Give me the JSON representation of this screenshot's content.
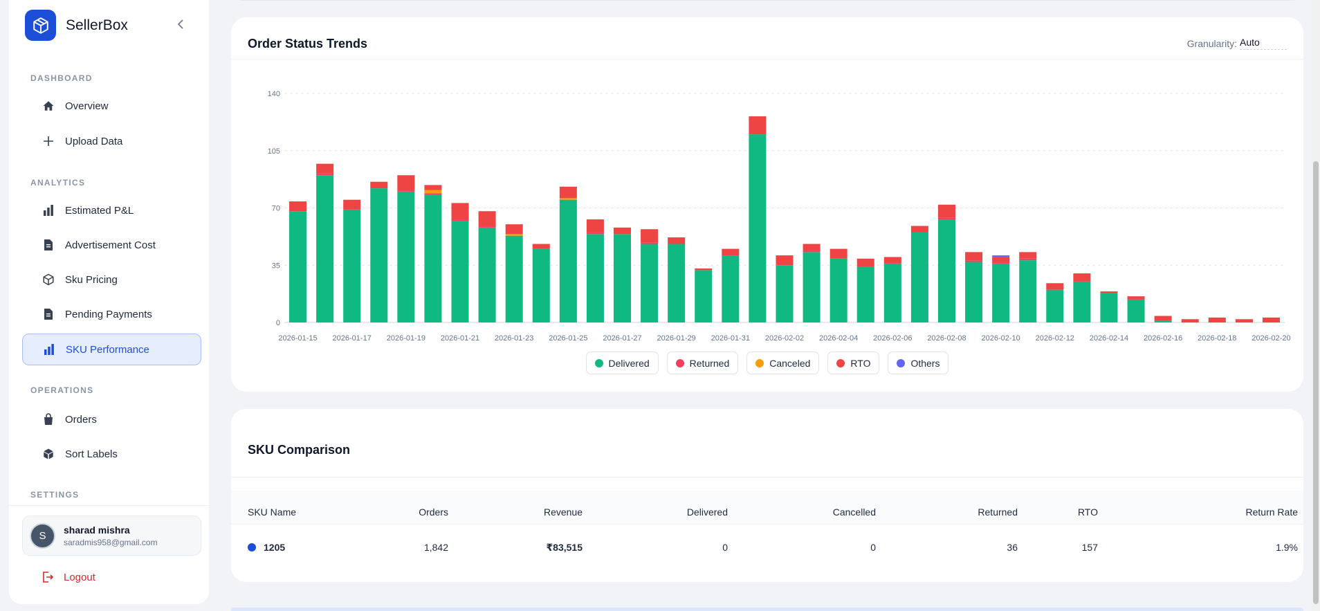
{
  "app": {
    "name": "SellerBox"
  },
  "sidebar": {
    "sections": {
      "dashboard": "DASHBOARD",
      "analytics": "ANALYTICS",
      "operations": "OPERATIONS",
      "settings": "SETTINGS"
    },
    "items": {
      "overview": "Overview",
      "upload": "Upload Data",
      "pnl": "Estimated P&L",
      "ads": "Advertisement Cost",
      "pricing": "Sku Pricing",
      "pending": "Pending Payments",
      "sku_perf": "SKU Performance",
      "orders": "Orders",
      "labels": "Sort Labels"
    },
    "icons": {
      "overview": "home-icon",
      "upload": "plus-icon",
      "pnl": "bar-chart-icon",
      "ads": "document-icon",
      "pricing": "box-icon",
      "pending": "document-icon",
      "sku_perf": "bar-chart-icon",
      "orders": "shopping-bag-icon",
      "labels": "cube-icon"
    },
    "user": {
      "initial": "S",
      "name": "sharad mishra",
      "email": "saradmis958@gmail.com"
    },
    "logout": "Logout"
  },
  "chart_card": {
    "title": "Order Status Trends",
    "granularity_label": "Granularity:",
    "granularity_value": "Auto"
  },
  "chart_data": {
    "type": "bar",
    "stacked": true,
    "title": "Order Status Trends",
    "ylim": [
      0,
      140
    ],
    "yticks": [
      0,
      35,
      70,
      105,
      140
    ],
    "grid": true,
    "legend_position": "bottom",
    "categories": [
      "2026-01-15",
      "2026-01-16",
      "2026-01-17",
      "2026-01-18",
      "2026-01-19",
      "2026-01-20",
      "2026-01-21",
      "2026-01-22",
      "2026-01-23",
      "2026-01-24",
      "2026-01-25",
      "2026-01-26",
      "2026-01-27",
      "2026-01-28",
      "2026-01-29",
      "2026-01-30",
      "2026-01-31",
      "2026-02-01",
      "2026-02-02",
      "2026-02-03",
      "2026-02-04",
      "2026-02-05",
      "2026-02-06",
      "2026-02-07",
      "2026-02-08",
      "2026-02-09",
      "2026-02-10",
      "2026-02-11",
      "2026-02-12",
      "2026-02-13",
      "2026-02-14",
      "2026-02-15",
      "2026-02-16",
      "2026-02-17",
      "2026-02-18",
      "2026-02-19",
      "2026-02-20"
    ],
    "x_tick_labels": [
      "2026-01-15",
      "2026-01-17",
      "2026-01-19",
      "2026-01-21",
      "2026-01-23",
      "2026-01-25",
      "2026-01-27",
      "2026-01-29",
      "2026-01-31",
      "2026-02-02",
      "2026-02-04",
      "2026-02-06",
      "2026-02-08",
      "2026-02-10",
      "2026-02-12",
      "2026-02-14",
      "2026-02-16",
      "2026-02-18",
      "2026-02-20"
    ],
    "series": [
      {
        "name": "Delivered",
        "color": "#10b981",
        "values": [
          68,
          90,
          69,
          82,
          80,
          78,
          62,
          58,
          53,
          45,
          75,
          54,
          54,
          48,
          48,
          32,
          41,
          115,
          35,
          43,
          39,
          34,
          36,
          55,
          63,
          37,
          36,
          38,
          20,
          25,
          18,
          14,
          1,
          0,
          0,
          0,
          0
        ]
      },
      {
        "name": "Returned",
        "color": "#f43f5e",
        "values": [
          0,
          1,
          0,
          0,
          1,
          1,
          1,
          1,
          0,
          0,
          0,
          1,
          0,
          1,
          0,
          0,
          0,
          0,
          0,
          1,
          0,
          0,
          0,
          0,
          1,
          1,
          1,
          1,
          0,
          0,
          0,
          0,
          0,
          0,
          0,
          0,
          0
        ]
      },
      {
        "name": "Canceled",
        "color": "#f59e0b",
        "values": [
          0,
          0,
          0,
          0,
          0,
          2,
          0,
          0,
          1,
          0,
          1,
          0,
          0,
          0,
          0,
          0,
          0,
          0,
          0,
          0,
          0,
          0,
          0,
          0,
          0,
          0,
          0,
          0,
          0,
          0,
          0,
          0,
          0,
          0,
          0,
          0,
          0
        ]
      },
      {
        "name": "RTO",
        "color": "#ef4444",
        "values": [
          6,
          6,
          6,
          4,
          9,
          3,
          10,
          9,
          6,
          3,
          7,
          8,
          4,
          8,
          4,
          1,
          4,
          11,
          6,
          4,
          6,
          5,
          4,
          4,
          8,
          5,
          3,
          4,
          4,
          5,
          1,
          2,
          3,
          2,
          3,
          2,
          3
        ]
      },
      {
        "name": "Others",
        "color": "#6366f1",
        "values": [
          0,
          0,
          0,
          0,
          0,
          0,
          0,
          0,
          0,
          0,
          0,
          0,
          0,
          0,
          0,
          0,
          0,
          0,
          0,
          0,
          0,
          0,
          0,
          0,
          0,
          0,
          1,
          0,
          0,
          0,
          0,
          0,
          0,
          0,
          0,
          0,
          0
        ]
      }
    ]
  },
  "table_card": {
    "title": "SKU Comparison",
    "headers": {
      "sku": "SKU Name",
      "orders": "Orders",
      "revenue": "Revenue",
      "delivered": "Delivered",
      "cancelled": "Cancelled",
      "returned": "Returned",
      "rto": "RTO",
      "return_rate": "Return Rate"
    },
    "rows": [
      {
        "dot_color": "#1d4ed8",
        "sku": "1205",
        "orders": "1,842",
        "revenue": "₹83,515",
        "delivered": "0",
        "cancelled": "0",
        "returned": "36",
        "rto": "157",
        "return_rate": "1.9%"
      }
    ]
  }
}
